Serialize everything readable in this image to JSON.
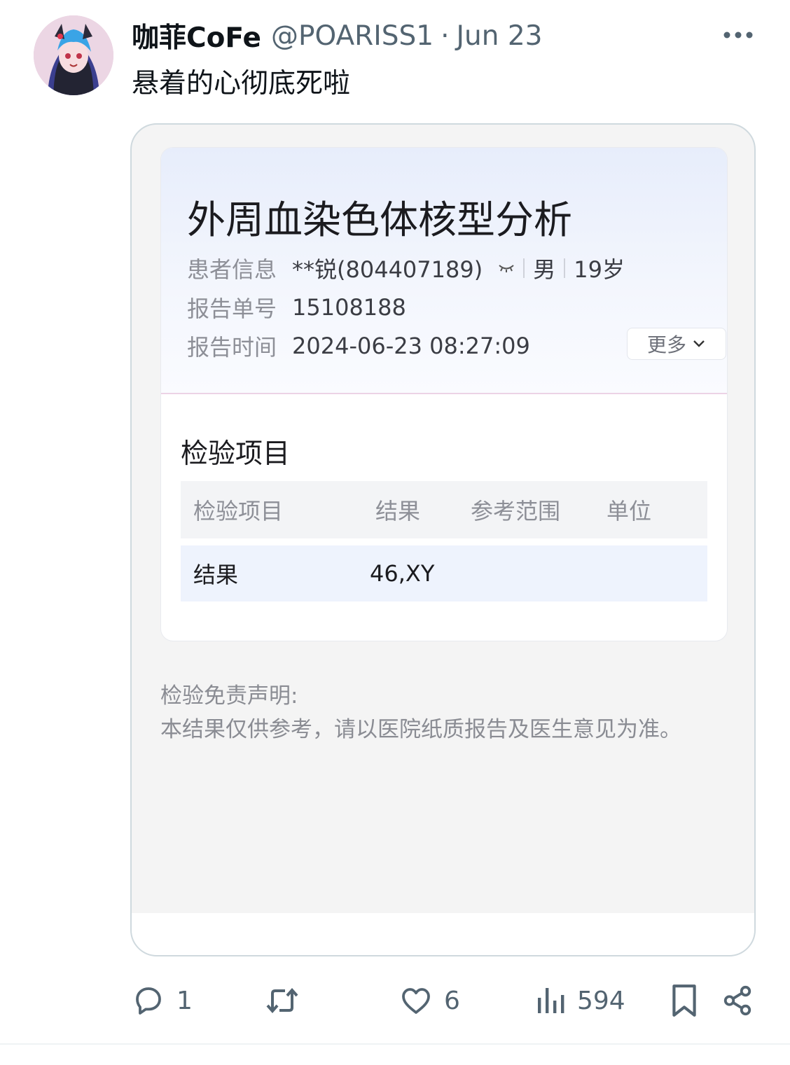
{
  "post": {
    "display_name": "咖菲CoFe",
    "handle": "@POARISS1",
    "separator": "·",
    "date": "Jun 23",
    "text": "悬着的心彻底死啦"
  },
  "report": {
    "title": "外周血染色体核型分析",
    "patient_label": "患者信息",
    "patient_name": "**锐(804407189)",
    "patient_sex": "男",
    "patient_age": "19岁",
    "report_no_label": "报告单号",
    "report_no": "15108188",
    "report_time_label": "报告时间",
    "report_time": "2024-06-23 08:27:09",
    "more_label": "更多",
    "section_title": "检验项目",
    "table": {
      "headers": [
        "检验项目",
        "结果",
        "参考范围",
        "单位"
      ],
      "rows": [
        {
          "item": "结果",
          "result": "46,XY",
          "range": "",
          "unit": ""
        }
      ]
    },
    "disclaimer_title": "检验免责声明:",
    "disclaimer_text": "本结果仅供参考，请以医院纸质报告及医生意见为准。"
  },
  "actions": {
    "replies": "1",
    "likes": "6",
    "views": "594"
  },
  "icons": [
    "more-icon",
    "reply-icon",
    "retweet-icon",
    "like-icon",
    "views-icon",
    "bookmark-icon",
    "share-icon",
    "eye-closed-icon",
    "chevron-down-icon"
  ]
}
